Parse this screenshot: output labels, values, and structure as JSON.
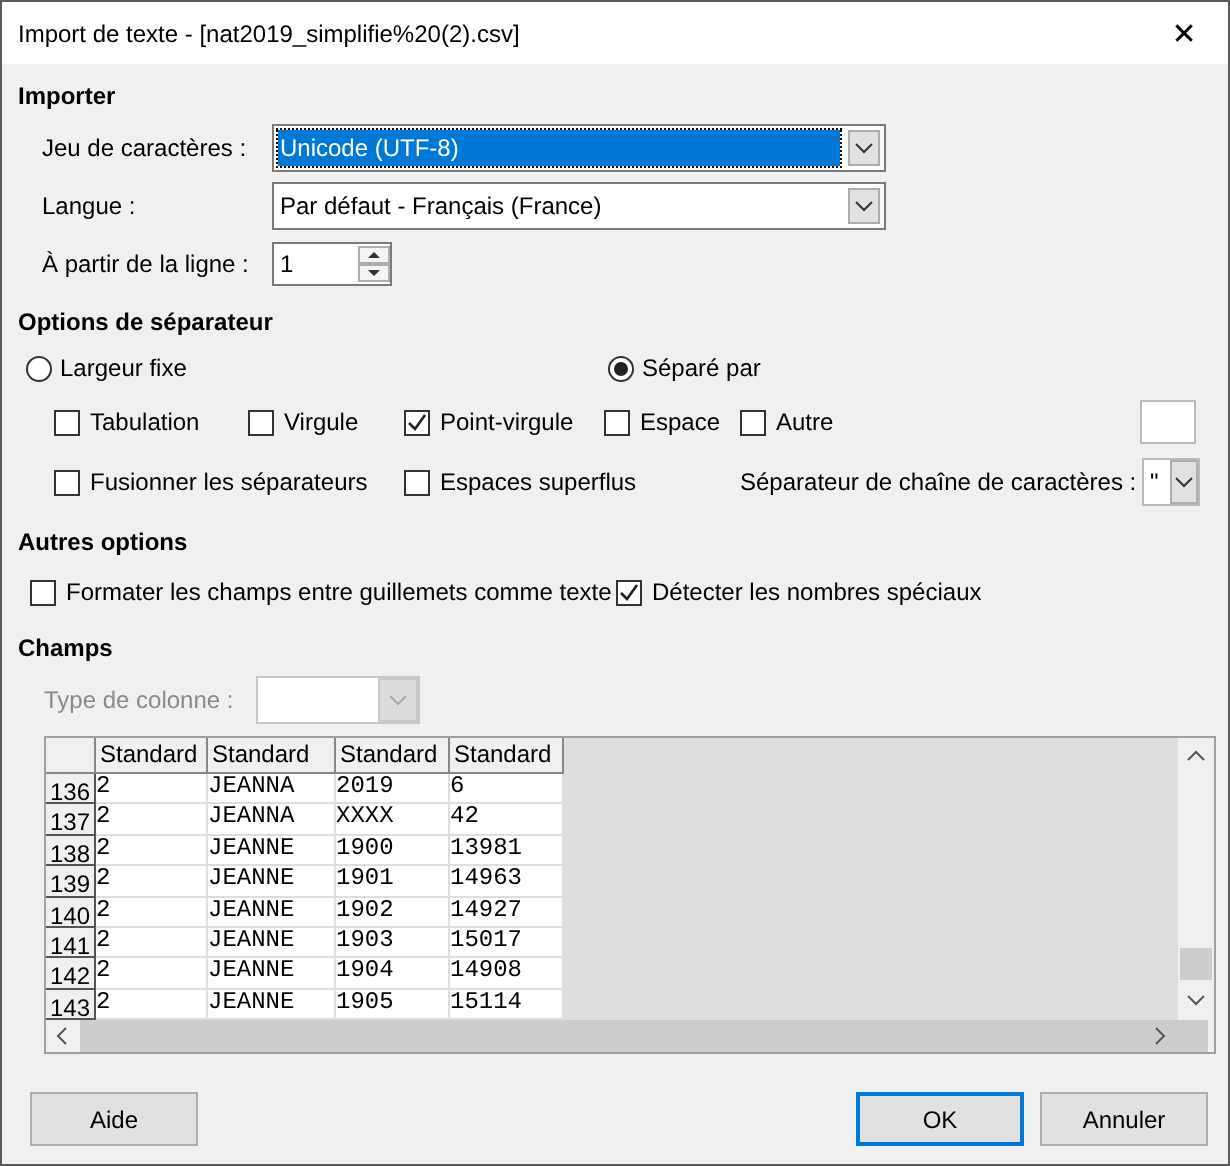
{
  "window": {
    "title": "Import de texte - [nat2019_simplifie%20(2).csv]",
    "close": "✕"
  },
  "import": {
    "heading": "Importer",
    "fields": [
      {
        "label": "Jeu de caractères :",
        "value": "Unicode (UTF-8)",
        "focused": true
      },
      {
        "label": "Langue :",
        "value": "Par défaut - Français (France)",
        "focused": false
      }
    ],
    "start_row": {
      "label": "À partir de la ligne :",
      "value": "1"
    }
  },
  "separator_options": {
    "heading": "Options de séparateur",
    "modes": [
      {
        "label": "Largeur fixe",
        "selected": false
      },
      {
        "label": "Séparé par",
        "selected": true
      }
    ],
    "separators": [
      {
        "label": "Tabulation",
        "checked": false
      },
      {
        "label": "Virgule",
        "checked": false
      },
      {
        "label": "Point-virgule",
        "checked": true
      },
      {
        "label": "Espace",
        "checked": false
      },
      {
        "label": "Autre",
        "checked": false
      }
    ],
    "extras": [
      {
        "label": "Fusionner les séparateurs",
        "checked": false
      },
      {
        "label": "Espaces superflus",
        "checked": false
      }
    ],
    "string_delimiter": {
      "label": "Séparateur de chaîne de caractères :",
      "value": "\""
    }
  },
  "other_options": {
    "heading": "Autres options",
    "options": [
      {
        "label": "Formater les champs entre guillemets comme texte",
        "checked": false
      },
      {
        "label": "Détecter les nombres spéciaux",
        "checked": true
      }
    ]
  },
  "fields": {
    "heading": "Champs",
    "column_type": {
      "label": "Type de colonne :",
      "disabled": true
    },
    "table": {
      "columns": [
        "Standard",
        "Standard",
        "Standard",
        "Standard"
      ],
      "rows": [
        {
          "number": "136",
          "cells": [
            "2",
            "JEANNA",
            "2019",
            "6"
          ]
        },
        {
          "number": "137",
          "cells": [
            "2",
            "JEANNA",
            "XXXX",
            "42"
          ]
        },
        {
          "number": "138",
          "cells": [
            "2",
            "JEANNE",
            "1900",
            "13981"
          ]
        },
        {
          "number": "139",
          "cells": [
            "2",
            "JEANNE",
            "1901",
            "14963"
          ]
        },
        {
          "number": "140",
          "cells": [
            "2",
            "JEANNE",
            "1902",
            "14927"
          ]
        },
        {
          "number": "141",
          "cells": [
            "2",
            "JEANNE",
            "1903",
            "15017"
          ]
        },
        {
          "number": "142",
          "cells": [
            "2",
            "JEANNE",
            "1904",
            "14908"
          ]
        },
        {
          "number": "143",
          "cells": [
            "2",
            "JEANNE",
            "1905",
            "15114"
          ]
        }
      ]
    }
  },
  "buttons": [
    {
      "label": "Aide",
      "default": false
    },
    {
      "label": "OK",
      "default": true
    },
    {
      "label": "Annuler",
      "default": false
    }
  ]
}
